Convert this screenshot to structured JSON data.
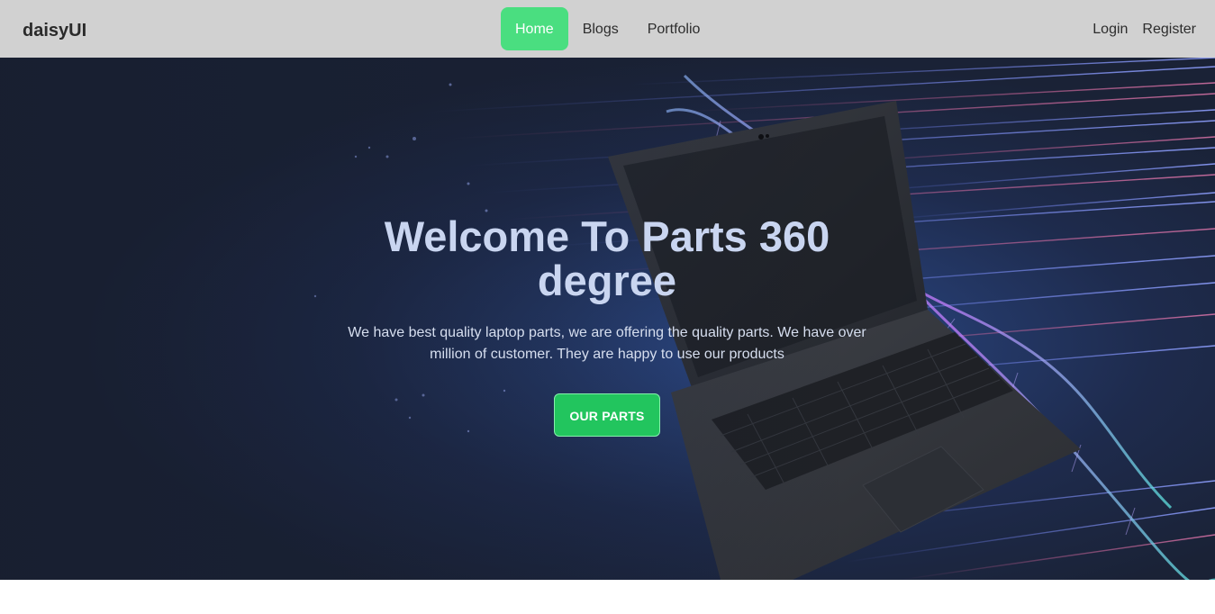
{
  "navbar": {
    "brand": "daisyUI",
    "links": [
      {
        "label": "Home"
      },
      {
        "label": "Blogs"
      },
      {
        "label": "Portfolio"
      }
    ],
    "auth": {
      "login": "Login",
      "register": "Register"
    }
  },
  "hero": {
    "title": "Welcome To Parts 360 degree",
    "description": "We have best quality laptop parts, we are offering the quality parts. We have over million of customer. They are happy to use our products",
    "button_label": "OUR PARTS",
    "background_image": "laptop-with-dna-light-streaks"
  },
  "colors": {
    "navbar_bg": "#d1d1d1",
    "active_link": "#4ade80",
    "primary_button": "#22c55e",
    "hero_title": "#c9d5f0"
  }
}
